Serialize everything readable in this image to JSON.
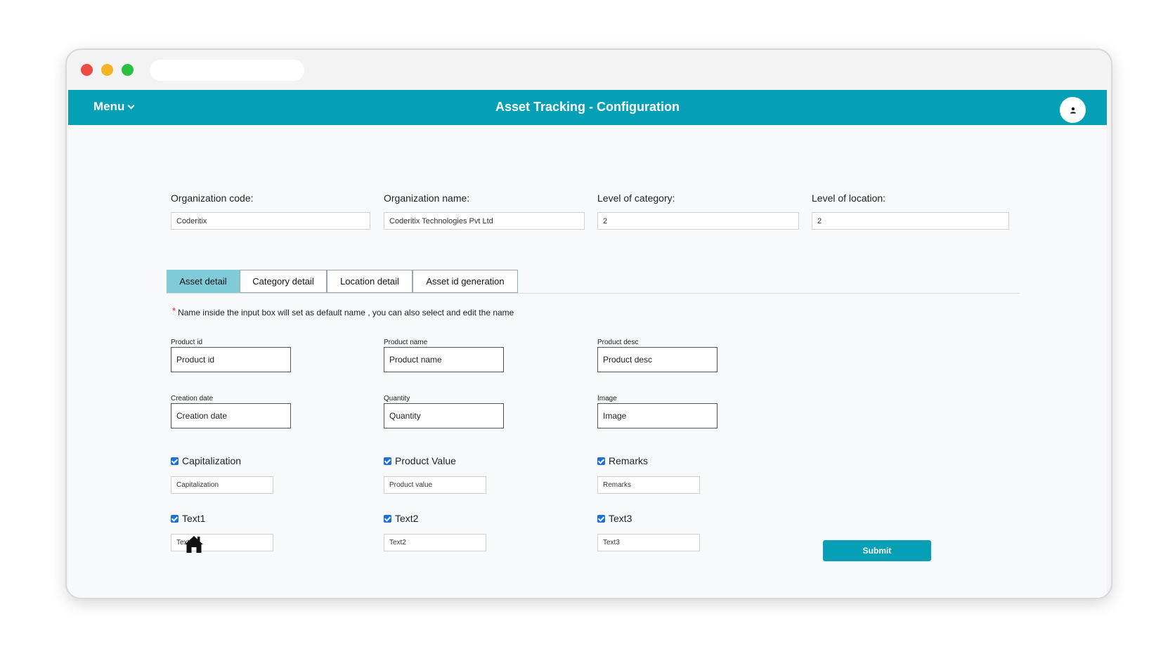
{
  "header": {
    "menu_label": "Menu",
    "title": "Asset Tracking - Configuration",
    "bg_color": "#05a0b5"
  },
  "organization": {
    "code_label": "Organization code:",
    "code_value": "Coderitix",
    "name_label": "Organization name:",
    "name_value": "Coderitix Technologies Pvt Ltd",
    "category_level_label": "Level of category:",
    "category_level_value": "2",
    "location_level_label": "Level of location:",
    "location_level_value": "2"
  },
  "tabs": [
    {
      "label": "Asset detail",
      "active": true
    },
    {
      "label": "Category detail",
      "active": false
    },
    {
      "label": "Location detail",
      "active": false
    },
    {
      "label": "Asset id generation",
      "active": false
    }
  ],
  "note": {
    "asterisk": "*",
    "text": "Name inside the input box will set as default name , you can also select and edit the name"
  },
  "fields": [
    {
      "label": "Product id",
      "value": "Product id"
    },
    {
      "label": "Product name",
      "value": "Product name"
    },
    {
      "label": "Product desc",
      "value": "Product desc"
    },
    {
      "label": "Creation date",
      "value": "Creation date"
    },
    {
      "label": "Quantity",
      "value": "Quantity"
    },
    {
      "label": "Image",
      "value": "Image"
    }
  ],
  "optional_fields": [
    {
      "label": "Capitalization",
      "checked": true,
      "value": "Capitalization"
    },
    {
      "label": "Product Value",
      "checked": true,
      "value": "Product value"
    },
    {
      "label": "Remarks",
      "checked": true,
      "value": "Remarks"
    },
    {
      "label": "Text1",
      "checked": true,
      "value": "Text1"
    },
    {
      "label": "Text2",
      "checked": true,
      "value": "Text2"
    },
    {
      "label": "Text3",
      "checked": true,
      "value": "Text3"
    }
  ],
  "actions": {
    "submit_label": "Submit",
    "home_icon": "home-icon"
  }
}
